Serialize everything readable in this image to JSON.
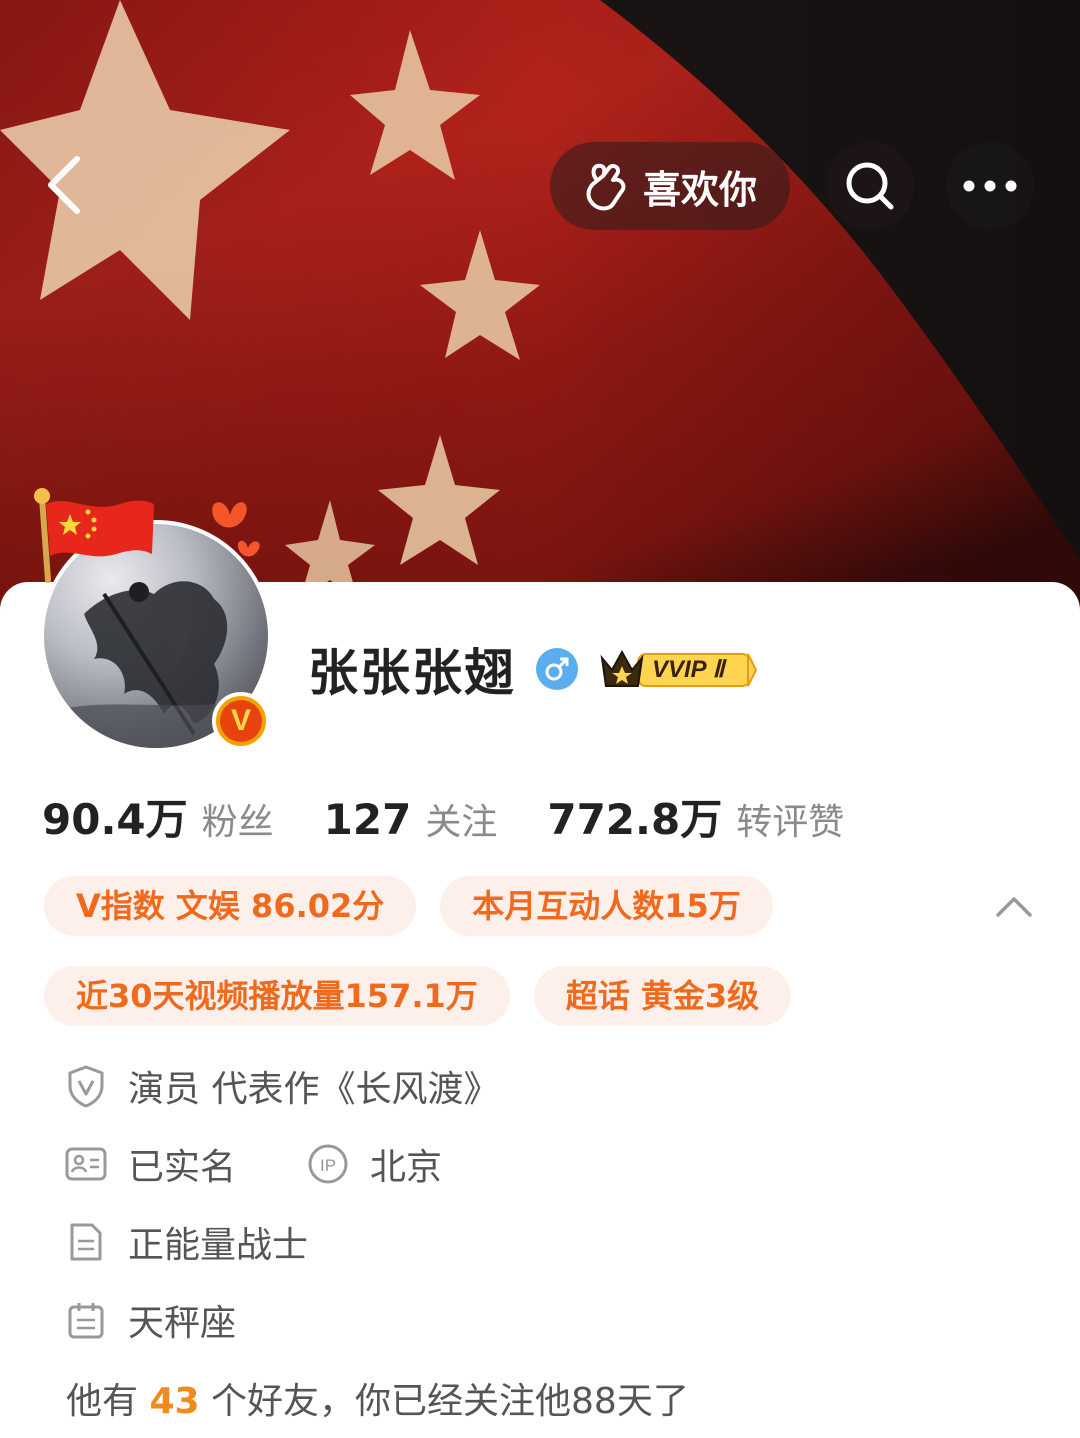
{
  "header": {
    "like_label": "喜欢你",
    "icons": {
      "back": "back-arrow-icon",
      "like": "finger-heart-icon",
      "search": "search-icon",
      "more": "more-dots-icon"
    }
  },
  "profile": {
    "name": "张张张翅",
    "gender": "male",
    "vip_label": "VVIP Ⅱ",
    "verified": "V"
  },
  "stats": [
    {
      "num": "90.4万",
      "label": "粉丝"
    },
    {
      "num": "127",
      "label": "关注"
    },
    {
      "num": "772.8万",
      "label": "转评赞"
    }
  ],
  "tags": {
    "row1": [
      "V指数 文娱 86.02分",
      "本月互动人数15万"
    ],
    "row2": [
      "近30天视频播放量157.1万",
      "超话 黄金3级"
    ]
  },
  "info": {
    "title": "演员 代表作《长风渡》",
    "realname": "已实名",
    "ip": "北京",
    "bio": "正能量战士",
    "zodiac": "天秤座"
  },
  "friends": {
    "prefix": "他有",
    "count": "43",
    "suffix": "个好友，你已经关注他88天了"
  },
  "colors": {
    "accent": "#f06a1d",
    "tag_bg": "#fdf0ea",
    "flag_red": "#b3231c",
    "gender_blue": "#5aaef0"
  }
}
